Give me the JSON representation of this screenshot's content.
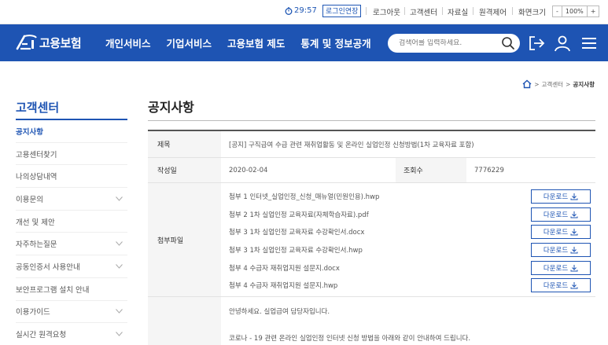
{
  "util": {
    "timer": "29:57",
    "extend_login": "로그인연장",
    "links": [
      "로그아웃",
      "고객센터",
      "자료실",
      "원격제어",
      "화면크기"
    ],
    "zoom_minus": "-",
    "zoom_value": "100%",
    "zoom_plus": "+"
  },
  "header": {
    "logo_text": "고용보험",
    "nav": [
      "개인서비스",
      "기업서비스",
      "고용보험 제도",
      "통계 및 정보공개"
    ],
    "search_placeholder": "검색어를 입력하세요."
  },
  "breadcrumb": {
    "items": [
      "고객센터",
      "공지사항"
    ],
    "separator": ">"
  },
  "sidebar": {
    "title": "고객센터",
    "items": [
      {
        "label": "공지사항",
        "active": true,
        "expandable": false
      },
      {
        "label": "고용센터찾기",
        "active": false,
        "expandable": false
      },
      {
        "label": "나의상담내역",
        "active": false,
        "expandable": false
      },
      {
        "label": "이용문의",
        "active": false,
        "expandable": true
      },
      {
        "label": "개선 및 제안",
        "active": false,
        "expandable": false
      },
      {
        "label": "자주하는질문",
        "active": false,
        "expandable": true
      },
      {
        "label": "공동인증서 사용안내",
        "active": false,
        "expandable": true
      },
      {
        "label": "보안프로그램 설치 안내",
        "active": false,
        "expandable": false
      },
      {
        "label": "이용가이드",
        "active": false,
        "expandable": true
      },
      {
        "label": "실시간 원격요청",
        "active": false,
        "expandable": true
      }
    ]
  },
  "main": {
    "page_title": "공지사항",
    "subject_label": "제목",
    "subject": "[공지] 구직급여 수급 관련 재취업활동 및 온라인 실업인정 신청방법(1차 교육자료 포함)",
    "date_label": "작성일",
    "date": "2020-02-04",
    "views_label": "조회수",
    "views": "7776229",
    "attach_label": "첨부파일",
    "download_label": "다운로드",
    "attachments": [
      "첨부 1 인터넷_실업인정_신청_매뉴얼(민원인용).hwp",
      "첨부 2 1차 실업인정 교육자료(자체학습자료).pdf",
      "첨부 3 1차 실업인정 교육자료 수강확인서.docx",
      "첨부 3 1차 실업인정 교육자료 수강확인서.hwp",
      "첨부 4 수급자 재취업지원 설문지.docx",
      "첨부 4 수급자 재취업지원 설문지.hwp"
    ],
    "body": [
      "안녕하세요. 실업급여 담당자입니다.",
      "코로나 - 19 관련 온라인 실업인정 인터넷 신청 방법을 아래와 같이 안내하여 드립니다."
    ]
  },
  "colors": {
    "brand": "#1e54b3",
    "header_bg": "#1e54b3"
  }
}
